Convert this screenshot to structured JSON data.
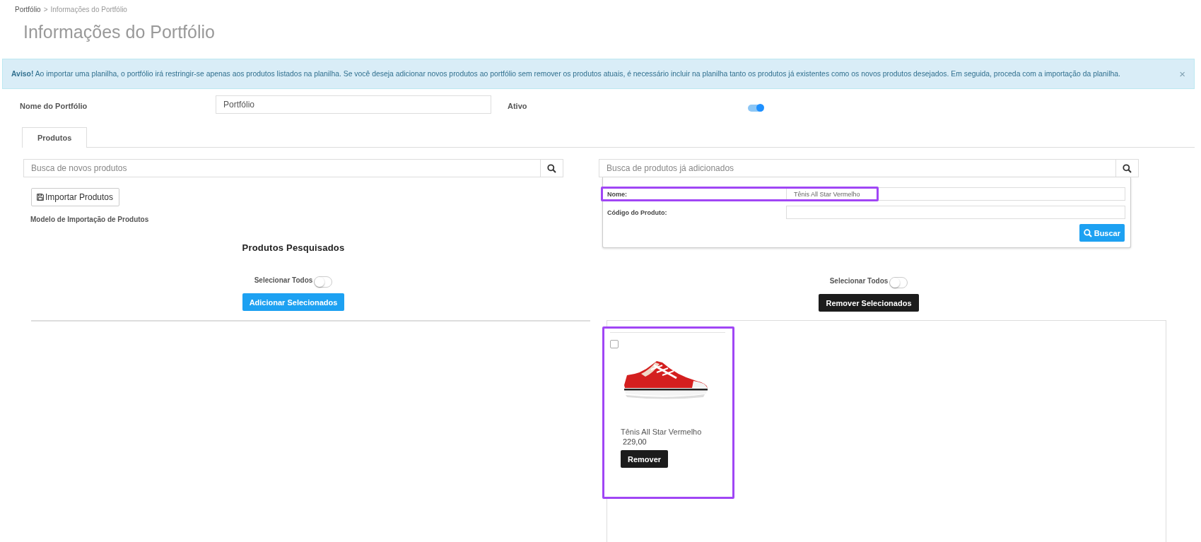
{
  "breadcrumb": {
    "items": [
      "Portfólio",
      "Informações do Portfólio"
    ],
    "separator": ">"
  },
  "page_title": "Informações do Portfólio",
  "alert": {
    "text": "**Aviso!** Ao importar uma planilha, o portfólio irá restringir-se apenas aos produtos listados na planilha. Se você deseja adicionar novos produtos ao portfólio sem remover os produtos atuais, é necessário incluir na planilha tanto os produtos já existentes como os novos produtos desejados. Em seguida, proceda com a importação da planilha.",
    "close": "×"
  },
  "form": {
    "name_label": "Nome do Portfólio",
    "name_value": "Portfólio",
    "active_label": "Ativo",
    "active_on": true
  },
  "tabs": [
    {
      "label": "Produtos",
      "selected": true
    }
  ],
  "left": {
    "search_placeholder": "Busca de novos produtos",
    "import_button": "Importar Produtos",
    "template_link": "Modelo de Importação de Produtos",
    "heading": "Produtos Pesquisados",
    "select_all": {
      "label": "Selecionar Todos",
      "on": false
    },
    "action_button": "Adicionar Selecionados"
  },
  "right": {
    "search_placeholder": "Busca de produtos já adicionados",
    "filter": {
      "fields": [
        {
          "label": "Nome:",
          "value": "Tênis All Star Vermelho",
          "highlighted": true
        },
        {
          "label": "Código do Produto:",
          "highlighted": false
        }
      ],
      "button": "Buscar"
    },
    "select_all": {
      "label": "Selecionar Todos",
      "on": false
    },
    "action_button": "Remover Selecionados",
    "products": [
      {
        "name": "Tênis All Star Vermelho",
        "price": "229,00",
        "checked": false,
        "button": "Remover",
        "highlighted": true
      }
    ]
  }
}
